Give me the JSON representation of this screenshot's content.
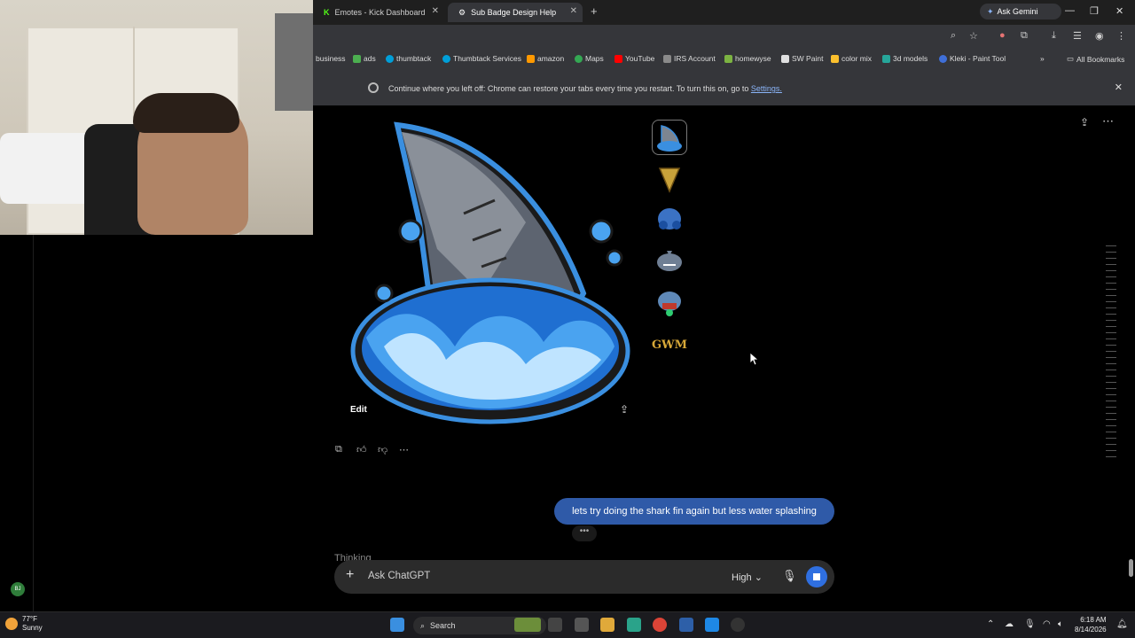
{
  "browser": {
    "tabs": [
      {
        "label": "Emotes - Kick Dashboard"
      },
      {
        "label": "Sub Badge Design Help"
      }
    ],
    "new_tab": "+",
    "gemini": "Ask Gemini",
    "bookmarks": [
      {
        "label": "business",
        "color": "#35363a"
      },
      {
        "label": "ads",
        "color": "#4caf50"
      },
      {
        "label": "thumbtack",
        "color": "#009fd9"
      },
      {
        "label": "Thumbtack Services",
        "color": "#009fd9"
      },
      {
        "label": "amazon",
        "color": "#ff9900"
      },
      {
        "label": "Maps",
        "color": "#34a853"
      },
      {
        "label": "YouTube",
        "color": "#ff0000"
      },
      {
        "label": "IRS Account",
        "color": "#8a8a8a"
      },
      {
        "label": "homewyse",
        "color": "#7cb342"
      },
      {
        "label": "SW Paint",
        "color": "#e0e0e0"
      },
      {
        "label": "color mix",
        "color": "#fbc02d"
      },
      {
        "label": "3d models",
        "color": "#26a69a"
      },
      {
        "label": "Kleki - Paint Tool",
        "color": "#3f6fd8"
      }
    ],
    "all_bookmarks": "All Bookmarks",
    "infobar_message": "Continue where you left off: Chrome can restore your tabs every time you restart. To turn this on, go to",
    "infobar_link": "Settings."
  },
  "chat": {
    "edit_label": "Edit",
    "user_message": "lets try doing the shark fin again but less water splashing",
    "typing_dots": "•••",
    "thinking": "Thinking",
    "composer_placeholder": "Ask ChatGPT",
    "model_level": "High",
    "thumbnails": [
      {
        "name": "shark-fin-wave",
        "selected": true
      },
      {
        "name": "gold-fin"
      },
      {
        "name": "blue-shark-boxer"
      },
      {
        "name": "grey-shark"
      },
      {
        "name": "shark-eating"
      },
      {
        "name": "gwm-text"
      }
    ],
    "thumb_gwm_text": "GWM"
  },
  "sidebar": {
    "avatar_initials": "BJ"
  },
  "taskbar": {
    "temperature": "77°F",
    "condition": "Sunny",
    "search": "Search",
    "time": "6:18 AM",
    "date": "8/14/2026"
  }
}
